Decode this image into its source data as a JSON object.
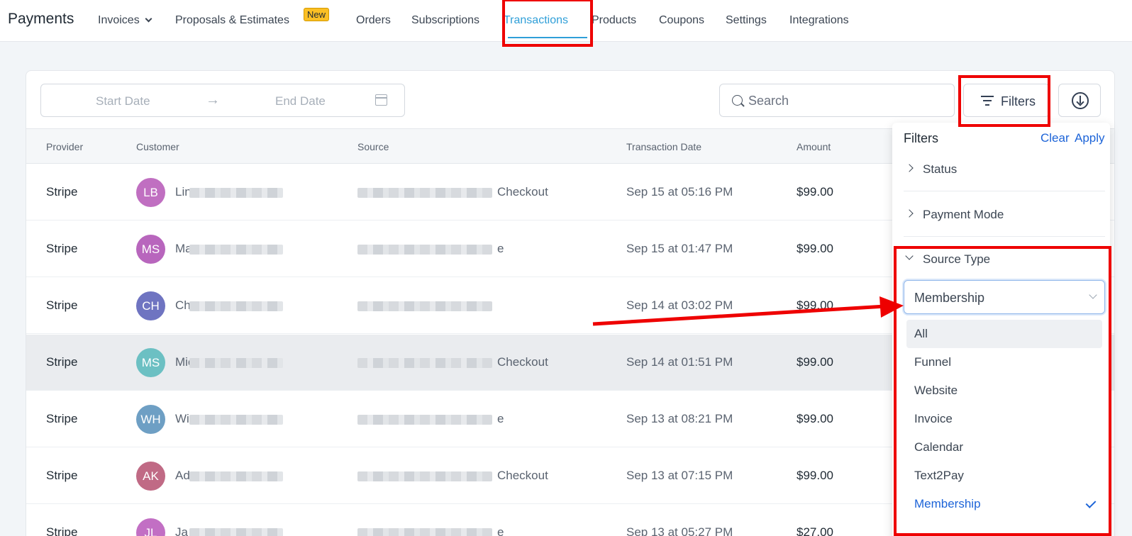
{
  "app": {
    "title": "Payments"
  },
  "nav": {
    "items": [
      {
        "label": "Invoices",
        "dropdown": true
      },
      {
        "label": "Proposals & Estimates",
        "badge": "New"
      },
      {
        "label": "Orders"
      },
      {
        "label": "Subscriptions"
      },
      {
        "label": "Transactions",
        "active": true
      },
      {
        "label": "Products"
      },
      {
        "label": "Coupons"
      },
      {
        "label": "Settings"
      },
      {
        "label": "Integrations"
      }
    ]
  },
  "toolbar": {
    "start_date_placeholder": "Start Date",
    "end_date_placeholder": "End Date",
    "arrow": "→",
    "search_placeholder": "Search",
    "filters_label": "Filters"
  },
  "table": {
    "headers": [
      "Provider",
      "Customer",
      "Source",
      "Transaction Date",
      "Amount"
    ],
    "rows": [
      {
        "provider": "Stripe",
        "initials": "LB",
        "avatar_color": "#c06fc1",
        "name_prefix": "Lin",
        "source_suffix": "Checkout",
        "date": "Sep 15 at 05:16 PM",
        "amount": "$99.00"
      },
      {
        "provider": "Stripe",
        "initials": "MS",
        "avatar_color": "#b866bd",
        "name_prefix": "Ma",
        "source_suffix": "e",
        "date": "Sep 15 at 01:47 PM",
        "amount": "$99.00"
      },
      {
        "provider": "Stripe",
        "initials": "CH",
        "avatar_color": "#6f74c1",
        "name_prefix": "Ch",
        "source_suffix": "",
        "date": "Sep 14 at 03:02 PM",
        "amount": "$99.00"
      },
      {
        "provider": "Stripe",
        "initials": "MS",
        "avatar_color": "#6cc0c3",
        "name_prefix": "Mic",
        "source_suffix": "Checkout",
        "date": "Sep 14 at 01:51 PM",
        "amount": "$99.00"
      },
      {
        "provider": "Stripe",
        "initials": "WH",
        "avatar_color": "#6e9fc4",
        "name_prefix": "Wi",
        "source_suffix": "e",
        "date": "Sep 13 at 08:21 PM",
        "amount": "$99.00"
      },
      {
        "provider": "Stripe",
        "initials": "AK",
        "avatar_color": "#c06a85",
        "name_prefix": "Ad",
        "source_suffix": "Checkout",
        "date": "Sep 13 at 07:15 PM",
        "amount": "$99.00"
      },
      {
        "provider": "Stripe",
        "initials": "JL",
        "avatar_color": "#c26fc4",
        "name_prefix": "Ja",
        "source_suffix": "e",
        "date": "Sep 13 at 05:27 PM",
        "amount": "$27.00"
      }
    ]
  },
  "filters_panel": {
    "title": "Filters",
    "clear_label": "Clear",
    "apply_label": "Apply",
    "sections": [
      {
        "label": "Status",
        "expanded": false
      },
      {
        "label": "Payment Mode",
        "expanded": false
      },
      {
        "label": "Source Type",
        "expanded": true
      }
    ],
    "source_type": {
      "selected": "Membership",
      "options": [
        "All",
        "Funnel",
        "Website",
        "Invoice",
        "Calendar",
        "Text2Pay",
        "Membership"
      ]
    }
  },
  "colors": {
    "accent": "#2f9fd8",
    "link": "#1d64d8",
    "annotation": "#ee0000",
    "badge": "#fbbf24"
  }
}
